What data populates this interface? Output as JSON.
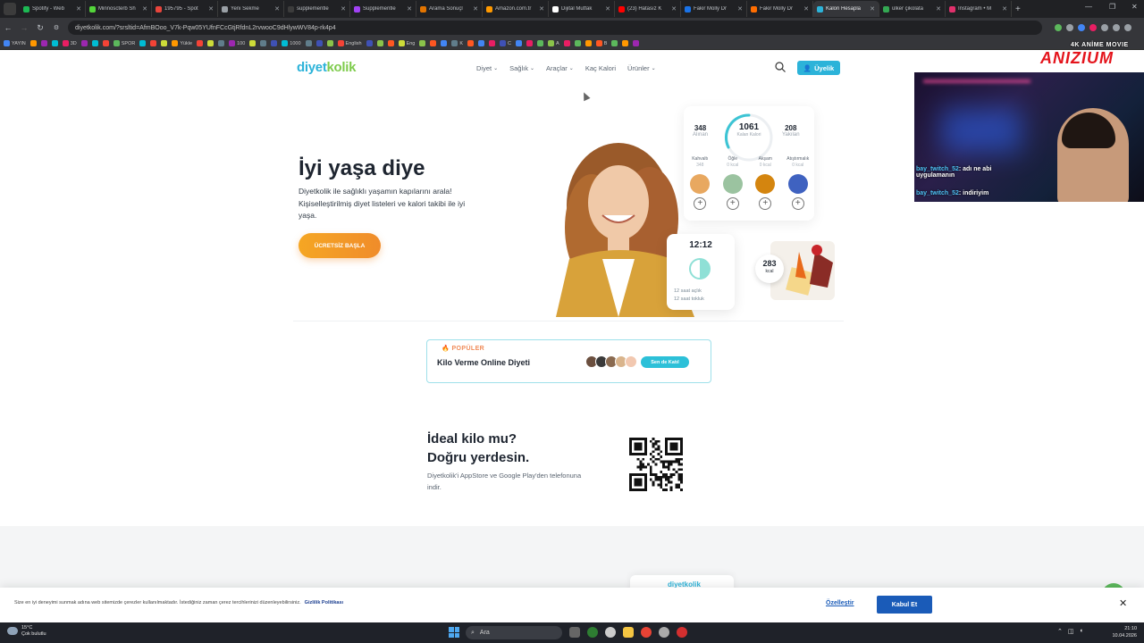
{
  "browser": {
    "tabs": [
      {
        "title": "Spotify - Web",
        "color": "#1db954"
      },
      {
        "title": "Minnoscterb Sh",
        "color": "#53d43a"
      },
      {
        "title": "195795 - Spot",
        "color": "#e8453c"
      },
      {
        "title": "Yeni Sekme",
        "color": "#9aa0a6"
      },
      {
        "title": "supplementle",
        "color": "#3c3c3c"
      },
      {
        "title": "Supplementle",
        "color": "#a142f4"
      },
      {
        "title": "Arama Sonuçl",
        "color": "#e37400"
      },
      {
        "title": "Amazon.com.tr",
        "color": "#ff9900"
      },
      {
        "title": "Dijital Mutfak",
        "color": "#ffffff"
      },
      {
        "title": "(23) Hatasız K",
        "color": "#ff0000"
      },
      {
        "title": "Fakir Molly Dr",
        "color": "#1a73e8"
      },
      {
        "title": "Fakir Molly Dr",
        "color": "#ff6d00"
      },
      {
        "title": "Kalori Hesapla",
        "color": "#2cb3d9"
      },
      {
        "title": "ülker çikolata",
        "color": "#34a853"
      },
      {
        "title": "Instagram • M",
        "color": "#e1306c"
      }
    ],
    "active_tab_index": 12,
    "new_tab_label": "+",
    "url": "diyetkolik.com/?srsltid=AfmBOoo_V7k-Pqw05YUfnFCcGtjRfdnL2rvwooC9dHlywWV84p-rk4p4",
    "bookmarks": [
      {
        "label": "YAYIN"
      },
      {
        "label": "3D"
      },
      {
        "label": "SPOR"
      },
      {
        "label": "Yükle"
      },
      {
        "label": "100"
      },
      {
        "label": "1000"
      },
      {
        "label": "English"
      },
      {
        "label": "Eng"
      },
      {
        "label": "K"
      },
      {
        "label": "C"
      },
      {
        "label": "A"
      },
      {
        "label": "B"
      }
    ]
  },
  "site": {
    "logo_main": "diyet",
    "logo_accent": "kolik",
    "nav": [
      "Diyet",
      "Sağlık",
      "Araçlar",
      "Kaç Kalori",
      "Ürünler"
    ],
    "nav_has_dropdown": [
      true,
      true,
      true,
      false,
      true
    ],
    "member_button": "Üyelik",
    "hero_title": "İyi yaşa diye",
    "hero_subtitle": "Diyetkolik ile sağlıklı yaşamın kapılarını arala! Kişiselleştirilmiş diyet listeleri ve kalori takibi ile iyi yaşa.",
    "cta_button": "ÜCRETSİZ BAŞLA",
    "calorie_card": {
      "taken_value": "348",
      "taken_label": "Alınan",
      "remaining_value": "1061",
      "remaining_label": "Kalan Kalori",
      "burned_value": "208",
      "burned_label": "Yakılan",
      "meals": [
        {
          "name": "Kahvaltı",
          "kcal": "348",
          "color": "#e8a860"
        },
        {
          "name": "Öğle",
          "kcal": "0 kcal",
          "color": "#9bc3a0"
        },
        {
          "name": "Akşam",
          "kcal": "0 kcal",
          "color": "#d4850f"
        },
        {
          "name": "Atıştırmalık",
          "kcal": "0 kcal",
          "color": "#3f62c0"
        }
      ]
    },
    "fasting_card": {
      "time": "12:12",
      "line1": "12 saat açlık",
      "line2": "12 saat tokluk"
    },
    "kcal_badge_value": "283",
    "kcal_badge_unit": "kcal",
    "popular": {
      "tag": "POPÜLER",
      "title": "Kilo Verme Online Diyeti",
      "button": "Sen de Katıl",
      "avatar_colors": [
        "#6b4f3f",
        "#3a3a3a",
        "#8a6a50",
        "#d9b48c",
        "#f2c8b0"
      ]
    },
    "app_section": {
      "title_line1": "İdeal kilo mu?",
      "title_line2": "Doğru yerdesin.",
      "subtitle": "Diyetkolik'i AppStore ve Google Play'den telefonuna indir."
    },
    "peek_logo": "diyetkolik"
  },
  "cookie_bar": {
    "message": "Size en iyi deneyimi sunmak adına web sitemizde çerezler kullanılmaktadır. İstediğiniz zaman çerez tercihlerinizi düzenleyebilirsiniz.",
    "policy_link": "Gizlilik Politikası",
    "customize": "Özelleştir",
    "accept": "Kabul Et",
    "close": "✕"
  },
  "taskbar": {
    "temperature": "15°C",
    "weather": "Çok bulutlu",
    "search": "Ara",
    "time": "21:10",
    "date": "10.04.2026"
  },
  "overlay": {
    "brand_top": "4K ANİME MOVIE",
    "brand_name": "ANIZIUM",
    "chat": [
      {
        "user": "bay_twitch_52",
        "text": ": adı ne abi",
        "text2": "uygulamanın"
      },
      {
        "user": "bay_twitch_52",
        "text": ": indiriyim",
        "text2": ""
      }
    ]
  }
}
